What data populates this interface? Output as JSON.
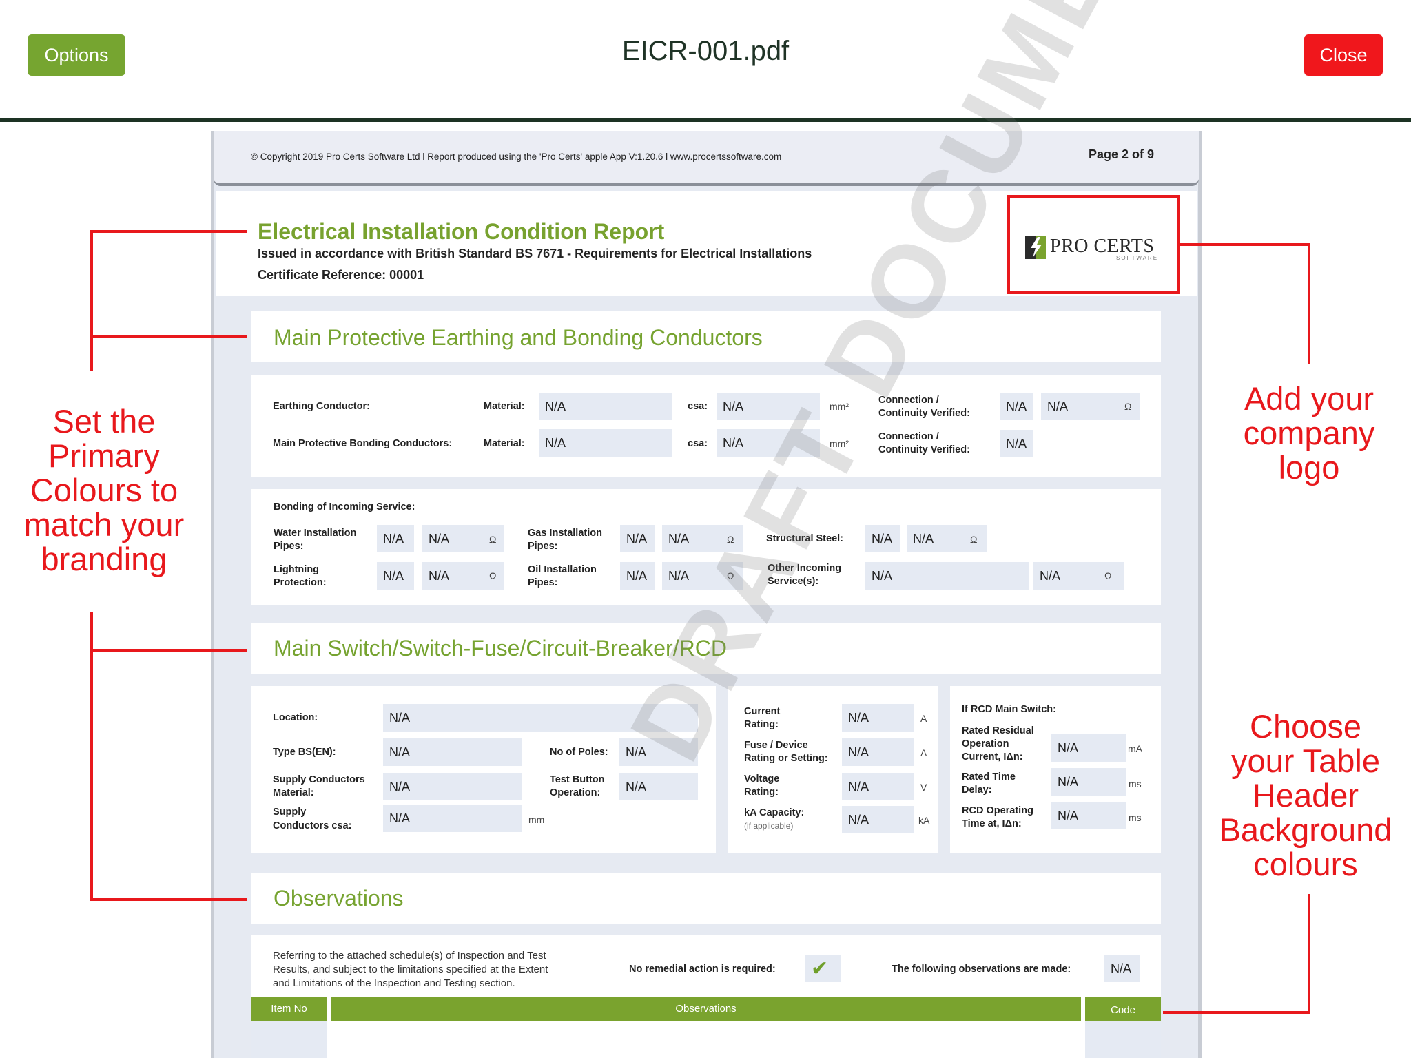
{
  "topbar": {
    "options_label": "Options",
    "title": "EICR-001.pdf",
    "close_label": "Close"
  },
  "document": {
    "copyright": "© Copyright 2019 Pro Certs Software Ltd l Report produced using the 'Pro Certs' apple App V:1.20.6 l www.procertssoftware.com",
    "page_label": "Page 2 of 9",
    "report_title": "Electrical Installation Condition Report",
    "report_subtitle": "Issued in accordance with British Standard BS 7671 - Requirements for Electrical Installations",
    "certificate_ref": "Certificate Reference: 00001",
    "logo_text": "PRO CERTS",
    "logo_subtext": "SOFTWARE",
    "watermark": "DRAFT DOCUMENT"
  },
  "earthing": {
    "title": "Main Protective Earthing and Bonding Conductors",
    "earthing_conductor": "Earthing Conductor:",
    "main_bonding": "Main Protective Bonding Conductors:",
    "material": "Material:",
    "csa": "csa:",
    "mm2": "mm²",
    "connection": "Connection /",
    "continuity": "Continuity Verified:",
    "ohm": "Ω",
    "values": {
      "ec_material": "N/A",
      "ec_csa": "N/A",
      "ec_conn": "N/A",
      "ec_conn_ohm": "N/A",
      "mb_material": "N/A",
      "mb_csa": "N/A",
      "mb_conn": "N/A"
    }
  },
  "bonding": {
    "title": "Bonding of Incoming Service:",
    "water_1": "Water Installation",
    "water_2": "Pipes:",
    "gas_1": "Gas Installation",
    "gas_2": "Pipes:",
    "steel": "Structural Steel:",
    "light_1": "Lightning",
    "light_2": "Protection:",
    "oil_1": "Oil Installation",
    "oil_2": "Pipes:",
    "other_1": "Other Incoming",
    "other_2": "Service(s):",
    "na": "N/A",
    "ohm": "Ω"
  },
  "mainswitch": {
    "title": "Main Switch/Switch-Fuse/Circuit-Breaker/RCD",
    "location": "Location:",
    "type_bs": "Type BS(EN):",
    "no_poles": "No of Poles:",
    "supply_mat_1": "Supply Conductors",
    "supply_mat_2": "Material:",
    "test_btn_1": "Test Button",
    "test_btn_2": "Operation:",
    "supply_csa_1": "Supply",
    "supply_csa_2": "Conductors csa:",
    "mm": "mm",
    "current_1": "Current",
    "current_2": "Rating:",
    "fuse_1": "Fuse / Device",
    "fuse_2": "Rating or Setting:",
    "voltage_1": "Voltage",
    "voltage_2": "Rating:",
    "ka_1": "kA Capacity:",
    "ka_2": "(if applicable)",
    "unit_a": "A",
    "unit_v": "V",
    "unit_ka": "kA",
    "rcd_title": "If RCD Main Switch:",
    "rated_res_1": "Rated Residual",
    "rated_res_2": "Operation",
    "rated_res_3": "Current, IΔn:",
    "rated_time_1": "Rated Time",
    "rated_time_2": "Delay:",
    "rcd_op_1": "RCD Operating",
    "rcd_op_2": "Time at, IΔn:",
    "unit_ma": "mA",
    "unit_ms": "ms",
    "na": "N/A"
  },
  "observations": {
    "title": "Observations",
    "text_1": "Referring to the attached schedule(s) of Inspection and Test",
    "text_2": "Results, and subject to the limitations specified at the Extent",
    "text_3": "and Limitations of the Inspection and Testing section.",
    "no_remedial": "No remedial action is required:",
    "check": "✔",
    "following": "The following observations are made:",
    "na": "N/A",
    "col_item": "Item No",
    "col_obs": "Observations",
    "col_code": "Code"
  },
  "annotations": {
    "primary": [
      "Set the",
      "Primary",
      "Colours to",
      "match your",
      "branding"
    ],
    "logo": [
      "Add your",
      "company",
      "logo"
    ],
    "table": [
      "Choose",
      "your Table",
      "Header",
      "Background",
      "colours"
    ]
  },
  "colors": {
    "primary_green": "#78a22f",
    "close_red": "#f0171c",
    "annotation_red": "#e8181c",
    "field_bg": "#e5eaf3"
  }
}
